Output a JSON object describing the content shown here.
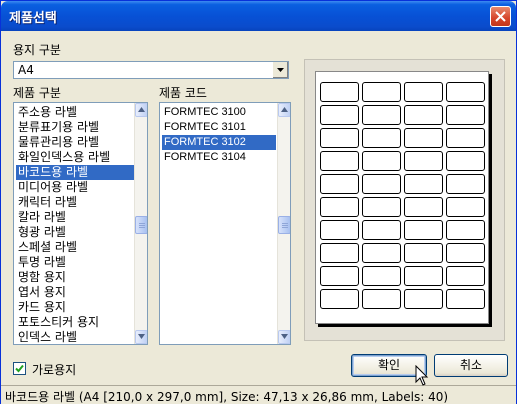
{
  "window": {
    "title": "제품선택"
  },
  "paper_type": {
    "label": "용지 구분",
    "value": "A4"
  },
  "product_category": {
    "label": "제품 구분",
    "items": [
      "주소용 라벨",
      "분류표기용 라벨",
      "물류관리용 라벨",
      "화일인덱스용 라벨",
      "바코드용 라벨",
      "미디어용 라벨",
      "캐릭터 라벨",
      "칼라 라벨",
      "형광 라벨",
      "스페셜 라벨",
      "투명 라벨",
      "명함 용지",
      "엽서 용지",
      "카드 용지",
      "포토스티커 용지",
      "인덱스 라벨"
    ],
    "selected": 4
  },
  "product_code": {
    "label": "제품 코드",
    "items": [
      "FORMTEC 3100",
      "FORMTEC 3101",
      "FORMTEC 3102",
      "FORMTEC 3104"
    ],
    "selected": 2
  },
  "preview": {
    "columns": 4,
    "rows": 10
  },
  "landscape": {
    "label": "가로용지",
    "checked": true
  },
  "buttons": {
    "ok": "확인",
    "cancel": "취소"
  },
  "status": {
    "text": "바코드용 라벨 (A4 [210,0 x 297,0 mm], Size: 47,13 x 26,86 mm,  Labels: 40)"
  }
}
